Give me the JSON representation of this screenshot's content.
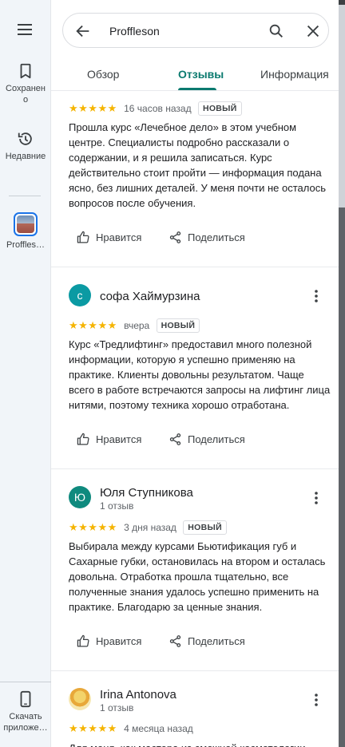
{
  "rail": {
    "saved_label": "Сохранено",
    "recent_label": "Недавние",
    "place_label": "Proffles…",
    "download_label": "Скачать приложе…"
  },
  "search": {
    "query": "Proffleson"
  },
  "tabs": [
    {
      "label": "Обзор"
    },
    {
      "label": "Отзывы"
    },
    {
      "label": "Информация"
    }
  ],
  "reviews": [
    {
      "stars": "★★★★★",
      "time": "16 часов назад",
      "badge": "НОВЫЙ",
      "text": "Прошла курс «Лечебное дело» в этом учебном центре. Специалисты подробно рассказали о содержании, и я решила записаться. Курс действительно стоит пройти — информация подана ясно, без лишних деталей. У меня почти не осталось вопросов после обучения.",
      "like": "Нравится",
      "share": "Поделиться"
    },
    {
      "author": "софа Хаймурзина",
      "avatar_letter": "с",
      "avatar_color": "#0b9aa3",
      "stars": "★★★★★",
      "time": "вчера",
      "badge": "НОВЫЙ",
      "text": "Курс «Тредлифтинг» предоставил много полезной информации, которую я успешно применяю на практике. Клиенты довольны результатом. Чаще всего в работе встречаются запросы на лифтинг лица нитями, поэтому техника хорошо отработана.",
      "like": "Нравится",
      "share": "Поделиться"
    },
    {
      "author": "Юля Ступникова",
      "author_sub": "1 отзыв",
      "avatar_letter": "Ю",
      "avatar_color": "#0f8a7e",
      "stars": "★★★★★",
      "time": "3 дня назад",
      "badge": "НОВЫЙ",
      "text": "Выбирала между курсами Бьютификация губ и Сахарные губки, остановилась на втором и осталась довольна. Отработка прошла тщательно, все полученные знания удалось успешно применить на практике. Благодарю за ценные знания.",
      "like": "Нравится",
      "share": "Поделиться"
    },
    {
      "author": "Irina Antonova",
      "author_sub": "1 отзыв",
      "stars": "★★★★★",
      "time": "4 месяца назад",
      "text": "Для меня, как мастера из смежной косметологии"
    }
  ]
}
